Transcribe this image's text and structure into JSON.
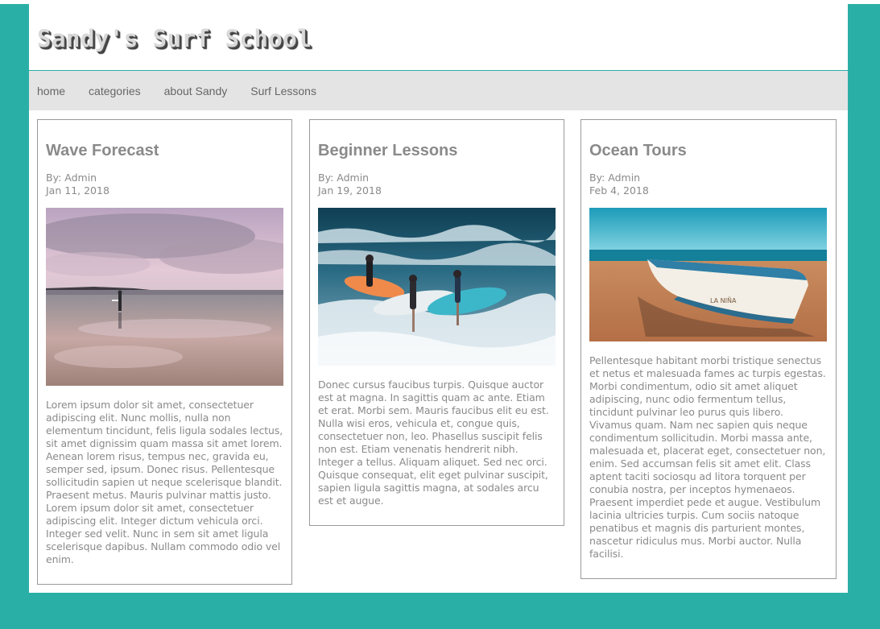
{
  "site": {
    "title": "Sandy's Surf School"
  },
  "nav": {
    "items": [
      {
        "label": "home"
      },
      {
        "label": "categories"
      },
      {
        "label": "about Sandy"
      },
      {
        "label": "Surf Lessons"
      }
    ]
  },
  "colors": {
    "page_background": "#2aafa6",
    "nav_background": "#e4e4e4",
    "text": "#8a8a8a"
  },
  "posts": [
    {
      "title": "Wave Forecast",
      "author": "By: Admin",
      "date": "Jan 11, 2018",
      "image": "beach-sunset-surfer-photo",
      "body": "Lorem ipsum dolor sit amet, consectetuer adipiscing elit. Nunc mollis, nulla non elementum tincidunt, felis ligula sodales lectus, sit amet dignissim quam massa sit amet lorem. Aenean lorem risus, tempus nec, gravida eu, semper sed, ipsum. Donec risus. Pellentesque sollicitudin sapien ut neque scelerisque blandit. Praesent metus. Mauris pulvinar mattis justo. Lorem ipsum dolor sit amet, consectetuer adipiscing elit. Integer dictum vehicula orci. Integer sed velit. Nunc in sem sit amet ligula scelerisque dapibus. Nullam commodo odio vel enim."
    },
    {
      "title": "Beginner Lessons",
      "author": "By: Admin",
      "date": "Jan 19, 2018",
      "image": "surfers-carrying-boards-photo",
      "body": "Donec cursus faucibus turpis. Quisque auctor est at magna. In sagittis quam ac ante. Etiam et erat. Morbi sem. Mauris faucibus elit eu est. Nulla wisi eros, vehicula et, congue quis, consectetuer non, leo. Phasellus suscipit felis non est. Etiam venenatis hendrerit nibh. Integer a tellus. Aliquam aliquet. Sed nec orci. Quisque consequat, elit eget pulvinar suscipit, sapien ligula sagittis magna, at sodales arcu est et augue."
    },
    {
      "title": "Ocean Tours",
      "author": "By: Admin",
      "date": "Feb 4, 2018",
      "image": "boat-on-beach-photo",
      "boat_label": "LA NIÑA",
      "body": "Pellentesque habitant morbi tristique senectus et netus et malesuada fames ac turpis egestas. Morbi condimentum, odio sit amet aliquet adipiscing, nunc odio fermentum tellus, tincidunt pulvinar leo purus quis libero. Vivamus quam. Nam nec sapien quis neque condimentum sollicitudin. Morbi massa ante, malesuada et, placerat eget, consectetuer non, enim. Sed accumsan felis sit amet elit. Class aptent taciti sociosqu ad litora torquent per conubia nostra, per inceptos hymenaeos. Praesent imperdiet pede et augue. Vestibulum lacinia ultricies turpis. Cum sociis natoque penatibus et magnis dis parturient montes, nascetur ridiculus mus. Morbi auctor. Nulla facilisi."
    }
  ]
}
